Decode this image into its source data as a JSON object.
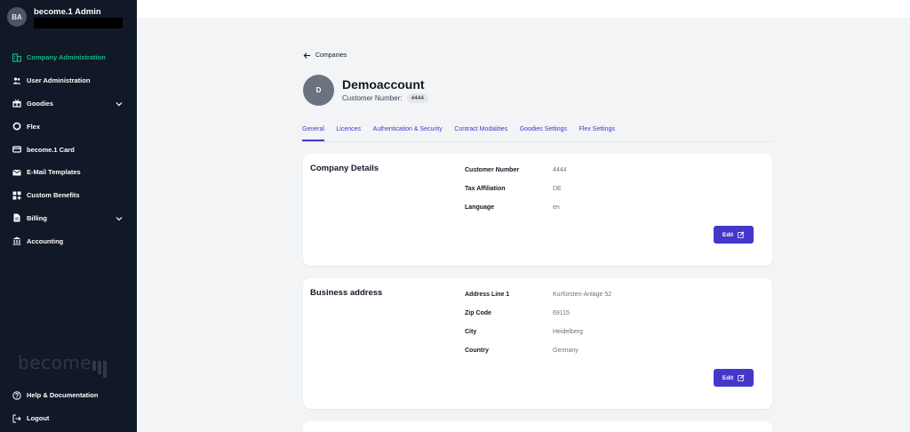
{
  "user": {
    "initials": "BA",
    "name": "become.1 Admin"
  },
  "sidebar": {
    "items": [
      {
        "label": "Company Administration",
        "icon": "building-icon",
        "active": true
      },
      {
        "label": "User Administration",
        "icon": "users-icon"
      },
      {
        "label": "Goodies",
        "icon": "gift-icon",
        "expandable": true
      },
      {
        "label": "Flex",
        "icon": "circle-icon"
      },
      {
        "label": "become.1 Card",
        "icon": "card-icon"
      },
      {
        "label": "E-Mail Templates",
        "icon": "mail-icon"
      },
      {
        "label": "Custom Benefits",
        "icon": "grid-plus-icon"
      },
      {
        "label": "Billing",
        "icon": "document-icon",
        "expandable": true
      },
      {
        "label": "Accounting",
        "icon": "bank-icon"
      }
    ],
    "brand": "become",
    "bottom": [
      {
        "label": "Help & Documentation",
        "icon": "help-icon"
      },
      {
        "label": "Logout",
        "icon": "logout-icon"
      }
    ]
  },
  "breadcrumb": {
    "back_label": "Companies"
  },
  "company": {
    "initial": "D",
    "name": "Demoaccount",
    "customer_number_label": "Customer Number:",
    "customer_number": "4444"
  },
  "tabs": [
    {
      "label": "General",
      "active": true
    },
    {
      "label": "Licences"
    },
    {
      "label": "Authentication & Security"
    },
    {
      "label": "Contract Modalities"
    },
    {
      "label": "Goodies Settings"
    },
    {
      "label": "Flex Settings"
    }
  ],
  "company_details": {
    "title": "Company Details",
    "fields": [
      {
        "label": "Customer Number",
        "value": "4444"
      },
      {
        "label": "Tax Affiliation",
        "value": "DE"
      },
      {
        "label": "Language",
        "value": "en"
      }
    ],
    "edit_label": "Edit"
  },
  "business_address": {
    "title": "Business address",
    "fields": [
      {
        "label": "Address Line 1",
        "value": "Kurfürsten-Anlage 52"
      },
      {
        "label": "Zip Code",
        "value": "69115"
      },
      {
        "label": "City",
        "value": "Heidelberg"
      },
      {
        "label": "Country",
        "value": "Germany"
      }
    ],
    "edit_label": "Edit"
  },
  "colors": {
    "sidebar_bg": "#111827",
    "active_nav": "#10b981",
    "accent": "#4338ca",
    "page_bg": "#f3f4f6"
  }
}
